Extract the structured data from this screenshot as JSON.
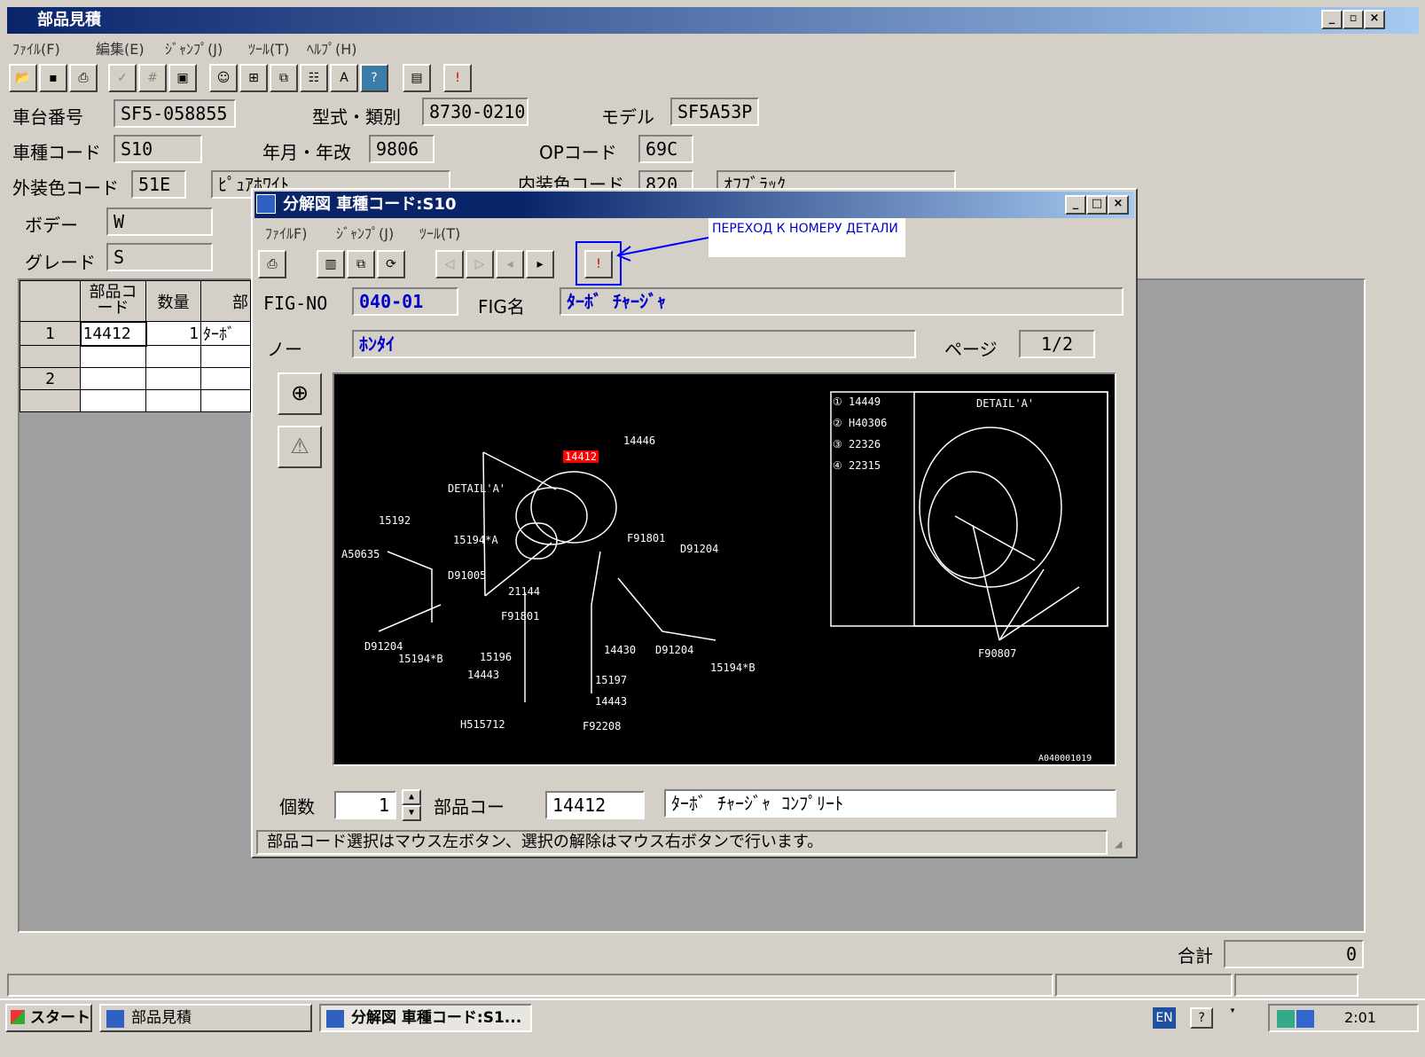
{
  "app": {
    "title": "部品見積"
  },
  "menu": [
    "ﾌｧｲﾙ(F)",
    "編集(E)",
    "ｼﾞｬﾝﾌﾟ(J)",
    "ﾂｰﾙ(T)",
    "ﾍﾙﾌﾟ(H)"
  ],
  "fields": {
    "chassis_label": "車台番号",
    "chassis_value": "SF5-058855",
    "type_label": "型式・類別",
    "type_value": "8730-0210",
    "model_label": "モデル",
    "model_value": "SF5A53P",
    "vehicle_code_label": "車種コード",
    "vehicle_code_value": "S10",
    "date_label": "年月・年改",
    "date_value": "9806",
    "op_label": "OPコード",
    "op_value": "69C",
    "ext_color_label": "外装色コード",
    "ext_color_code": "51E",
    "ext_color_name": "ﾋﾟｭｱﾎﾜｲﾄ",
    "int_color_label": "内装色コード",
    "int_color_code": "820",
    "int_color_name": "ｵﾌﾌﾞﾗｯｸ",
    "body_label": "ボデー",
    "body_value": "W",
    "grade_label": "グレード",
    "grade_value": "S"
  },
  "grid": {
    "headers": [
      "部品コード",
      "数量",
      "部"
    ],
    "rows": [
      {
        "no": "1",
        "code": "14412",
        "qty": "1",
        "name": "ﾀｰﾎﾞ"
      },
      {
        "no": "2",
        "code": "",
        "qty": "",
        "name": ""
      }
    ]
  },
  "total": {
    "label": "合計",
    "value": "0"
  },
  "child": {
    "title": "分解図 車種コード:S10",
    "menu": [
      "ﾌｧｲﾙF)",
      "ｼﾞｬﾝﾌﾟ(J)",
      "ﾂｰﾙ(T)"
    ],
    "annotation": "ПЕРЕХОД К НОМЕРУ ДЕТАЛИ",
    "fig_no_label": "FIG-NO",
    "fig_no_value": "040-01",
    "fig_name_label": "FIG名",
    "fig_name_value": "ﾀｰﾎﾞ ﾁｬｰｼﾞｬ",
    "no_label": "ノー",
    "no_value": "ﾎﾝﾀｲ",
    "page_label": "ページ",
    "page_value": "1/2",
    "qty_label": "個数",
    "qty_value": "1",
    "part_code_label": "部品コー",
    "part_code_value": "14412",
    "part_name_value": "ﾀｰﾎﾞ ﾁｬｰｼﾞｬ ｺﾝﾌﾟﾘｰﾄ",
    "status": "部品コード選択はマウス左ボタン、選択の解除はマウス右ボタンで行います。"
  },
  "diagram": {
    "labels": [
      "14446",
      "DETAIL'A'",
      "15192",
      "15194*A",
      "A50635",
      "D91005",
      "F91801",
      "D91204",
      "21144",
      "F91801",
      "D91204",
      "15194*B",
      "15196",
      "14443",
      "14430",
      "D91204",
      "15194*B",
      "15197",
      "14443",
      "H515712",
      "F92208",
      "F90807",
      "A040001019"
    ],
    "highlight": "14412",
    "legend": [
      "① 14449",
      "② H40306",
      "③ 22326",
      "④ 22315"
    ],
    "detail_title": "DETAIL'A'"
  },
  "taskbar": {
    "start": "スタート",
    "task1": "部品見積",
    "task2": "分解図 車種コード:S1...",
    "lang": "EN",
    "clock": "2:01"
  }
}
